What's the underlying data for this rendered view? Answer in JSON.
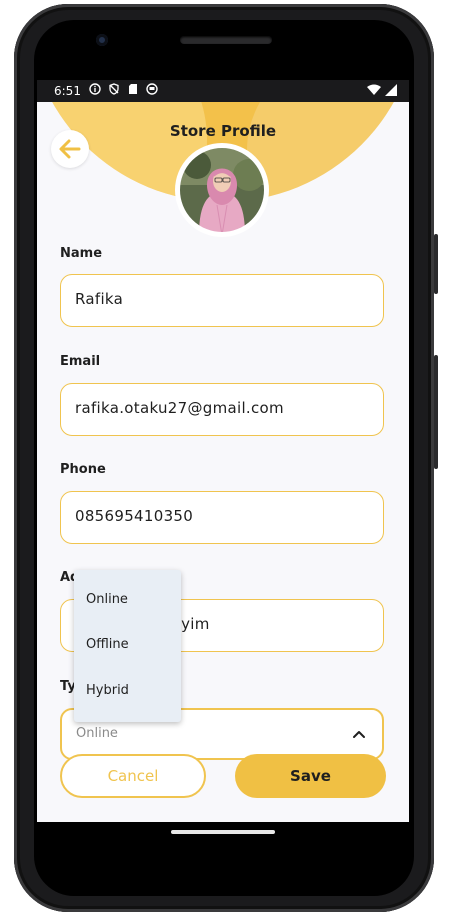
{
  "status_bar": {
    "time": "6:51"
  },
  "header": {
    "title": "Store Profile"
  },
  "form": {
    "name_label": "Name",
    "name_value": "Rafika",
    "email_label": "Email",
    "email_value": "rafika.otaku27@gmail.com",
    "phone_label": "Phone",
    "phone_value": "085695410350",
    "address_label_visible": "Ad",
    "address_value_visible": "syim",
    "type_label_visible": "Ty",
    "type_selected": "Online"
  },
  "dropdown": {
    "options": [
      "Online",
      "Offline",
      "Hybrid"
    ]
  },
  "actions": {
    "cancel_label": "Cancel",
    "save_label": "Save"
  },
  "colors": {
    "accent": "#f0c044",
    "header": "#f3c14a",
    "field_border": "#f0c44f",
    "dropdown_bg": "#e8eef5"
  }
}
